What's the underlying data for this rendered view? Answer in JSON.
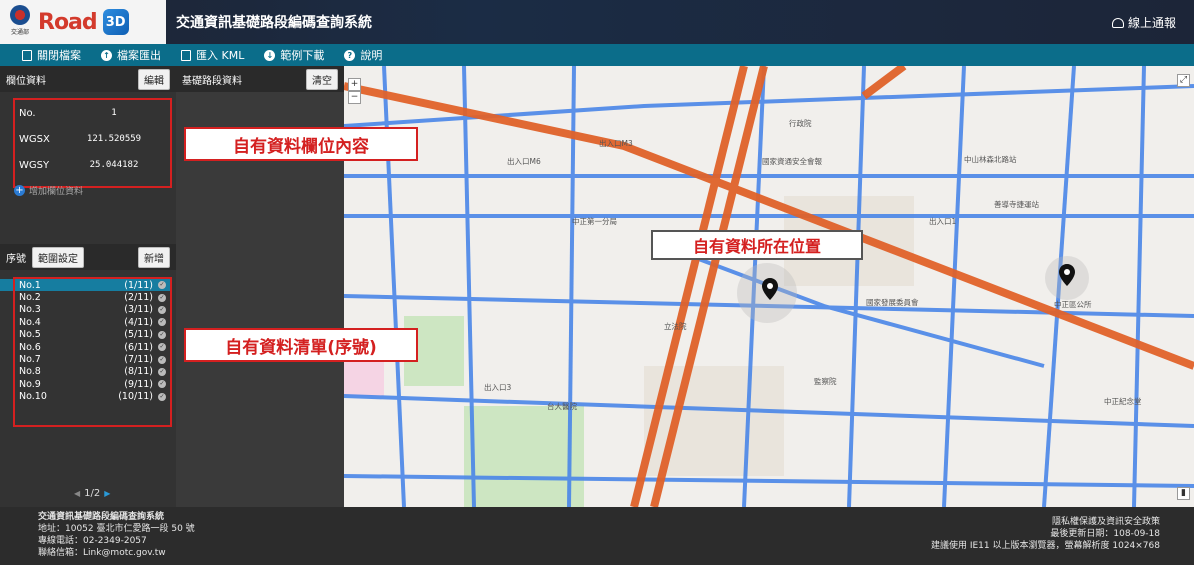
{
  "header": {
    "emblem_text": "交通部",
    "brand": "Road",
    "brand_badge": "3D",
    "system_title": "交通資訊基礎路段編碼查詢系統",
    "report_label": "線上通報"
  },
  "toolbar": {
    "items": [
      {
        "label": "關閉檔案",
        "icon": "file-icon"
      },
      {
        "label": "檔案匯出",
        "icon": "upload-icon"
      },
      {
        "label": "匯入 KML",
        "icon": "file-icon"
      },
      {
        "label": "範例下載",
        "icon": "download-icon"
      },
      {
        "label": "說明",
        "icon": "help-icon"
      }
    ]
  },
  "field_panel": {
    "title": "欄位資料",
    "edit_label": "編輯",
    "fields": [
      {
        "key": "No.",
        "value": "1"
      },
      {
        "key": "WGSX",
        "value": "121.520559"
      },
      {
        "key": "WGSY",
        "value": "25.044182"
      }
    ],
    "add_field_label": "增加欄位資料"
  },
  "segment_panel": {
    "title": "基礎路段資料",
    "clear_label": "清空"
  },
  "sequence_panel": {
    "title": "序號",
    "range_label": "範圍設定",
    "add_label": "新增",
    "rows": [
      {
        "name": "No.1",
        "count": "(1/11)"
      },
      {
        "name": "No.2",
        "count": "(2/11)"
      },
      {
        "name": "No.3",
        "count": "(3/11)"
      },
      {
        "name": "No.4",
        "count": "(4/11)"
      },
      {
        "name": "No.5",
        "count": "(5/11)"
      },
      {
        "name": "No.6",
        "count": "(6/11)"
      },
      {
        "name": "No.7",
        "count": "(7/11)"
      },
      {
        "name": "No.8",
        "count": "(8/11)"
      },
      {
        "name": "No.9",
        "count": "(9/11)"
      },
      {
        "name": "No.10",
        "count": "(10/11)"
      }
    ],
    "selected_index": 0,
    "pager": "1/2"
  },
  "callouts": {
    "fields": "自有資料欄位內容",
    "location": "自有資料所在位置",
    "list": "自有資料清單(序號)"
  },
  "map_labels": [
    "行政院",
    "國家資通安全會報",
    "出入口M6",
    "出入口M3",
    "中正第一分局",
    "中正區公所",
    "台大醫院",
    "立法院",
    "監察院",
    "國家發展委員會",
    "中山林森北路站",
    "善導寺捷運站",
    "中正紀念堂",
    "出入口1",
    "出入口3"
  ],
  "footer": {
    "title": "交通資訊基礎路段編碼查詢系統",
    "address": "地址：10052 臺北市仁愛路一段 50 號",
    "phone": "專線電話：02-2349-2057",
    "email": "聯絡信箱：Link@motc.gov.tw",
    "privacy": "隱私權保護及資訊安全政策",
    "updated": "最後更新日期：108-09-18",
    "browser": "建議使用 IE11 以上版本瀏覽器，螢幕解析度 1024×768"
  },
  "colors": {
    "header_bg": "#1b2c45",
    "toolbar_bg": "#0b6d8a",
    "panel_bg": "#333333",
    "highlight_red": "#d42020",
    "selected_row": "#167da0",
    "road_blue": "#4a86e8",
    "road_orange": "#e0622a"
  }
}
